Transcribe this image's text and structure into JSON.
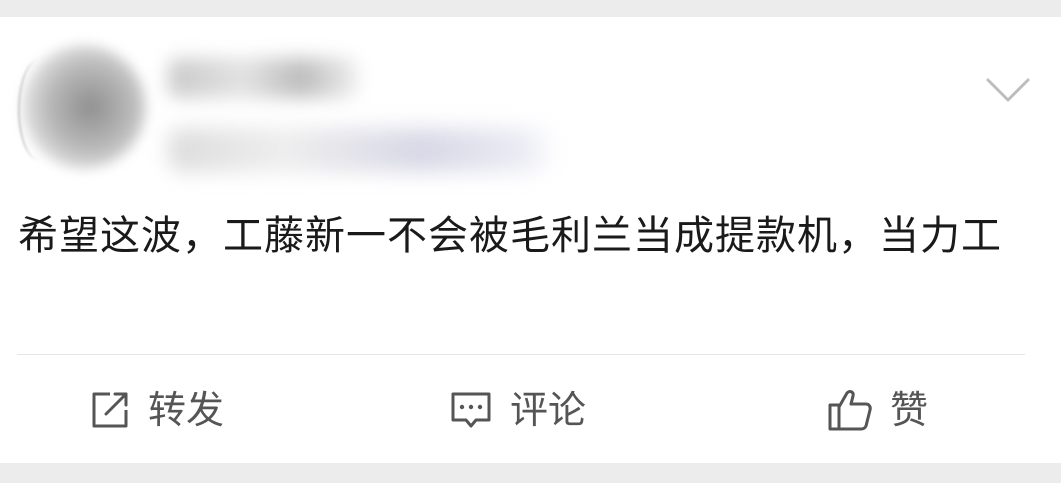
{
  "post": {
    "text": "希望这波，工藤新一不会被毛利兰当成提款机，当力工"
  },
  "header": {
    "avatar_icon": "blurred-avatar",
    "menu_icon": "chevron-down-icon"
  },
  "actions": {
    "repost": {
      "label": "转发",
      "icon": "share-arrow-icon"
    },
    "comment": {
      "label": "评论",
      "icon": "comment-bubble-icon"
    },
    "like": {
      "label": "赞",
      "icon": "thumbs-up-icon"
    }
  },
  "colors": {
    "background": "#ededed",
    "card": "#ffffff",
    "text": "#1a1a1a",
    "action_text": "#555555",
    "divider": "#e5e5e5"
  }
}
